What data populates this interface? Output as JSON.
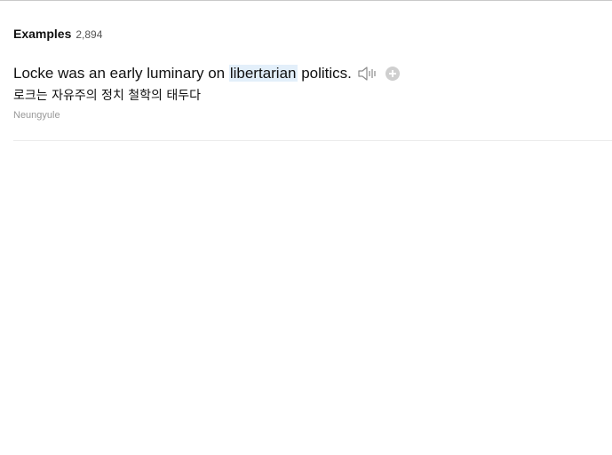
{
  "header": {
    "title": "Examples",
    "count": "2,894"
  },
  "example": {
    "en_before": "Locke was an early luminary on ",
    "en_highlight": "libertarian",
    "en_after": " politics.",
    "ko": "로크는 자유주의 정치 철학의 태두다",
    "source": "Neungyule"
  },
  "icons": {
    "audio": "speaker-icon",
    "add": "add-icon"
  },
  "colors": {
    "highlight": "#e3effa",
    "add_icon": "#cfcfcf",
    "source_text": "#999999"
  }
}
